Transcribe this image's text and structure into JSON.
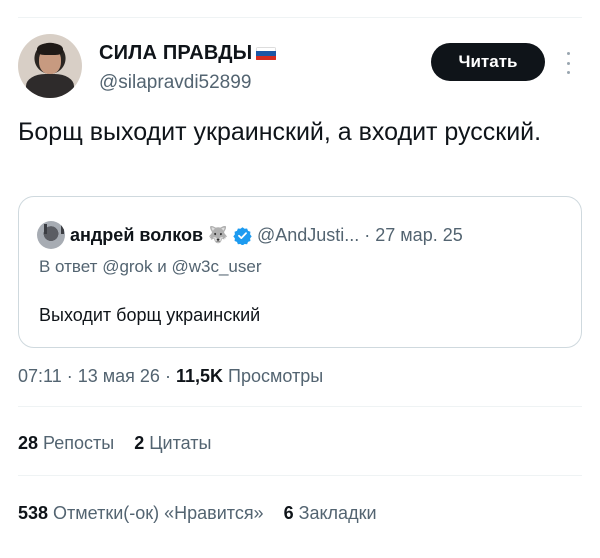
{
  "author": {
    "display_name": "СИЛА ПРАВДЫ",
    "handle": "@silapravdi52899",
    "flag_icon": "russia-flag-icon",
    "flag_colors": [
      "#ffffff",
      "#1c57a5",
      "#d52b1e"
    ]
  },
  "follow_button": {
    "label": "Читать"
  },
  "more_icon": "more-vertical-icon",
  "tweet": {
    "text": "Борщ выходит украинский, а входит русский."
  },
  "quote": {
    "display_name": "андрей волков",
    "name_emoji": "🐺",
    "handle": "@AndJusti...",
    "separator": "·",
    "date": "27 мар. 25",
    "reply_prefix": "В ответ",
    "reply_user_1": "@grok",
    "reply_conj": "и",
    "reply_user_2": "@w3c_user",
    "text": "Выходит борщ украинский",
    "verified_color": "#1d9bf0"
  },
  "meta": {
    "time": "07:11",
    "sep1": "·",
    "date": "13 мая 26",
    "sep2": "·",
    "views_count": "11,5K",
    "views_label": "Просмотры"
  },
  "stats_row_1": {
    "reposts_count": "28",
    "reposts_label": "Репосты",
    "quotes_count": "2",
    "quotes_label": "Цитаты"
  },
  "stats_row_2": {
    "likes_count": "538",
    "likes_label": "Отметки(-ок) «Нравится»",
    "bookmarks_count": "6",
    "bookmarks_label": "Закладки"
  }
}
